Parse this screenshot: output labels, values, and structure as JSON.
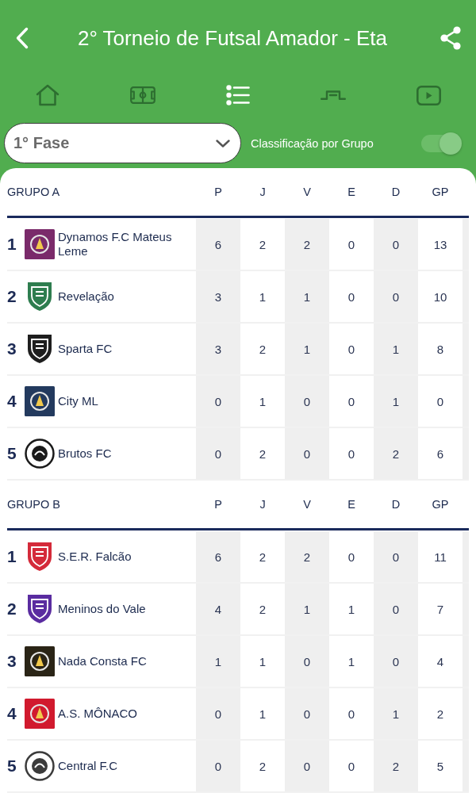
{
  "header": {
    "title": "2° Torneio de Futsal Amador - Eta"
  },
  "nav_tabs": [
    {
      "kind": "home",
      "selected": false
    },
    {
      "kind": "field",
      "selected": false
    },
    {
      "kind": "list",
      "selected": true
    },
    {
      "kind": "bracket",
      "selected": false
    },
    {
      "kind": "video",
      "selected": false
    }
  ],
  "phase_select": {
    "value": "1° Fase"
  },
  "group_toggle": {
    "label": "Classificação por Grupo",
    "on": true
  },
  "groups": [
    {
      "title": "GRUPO A",
      "columns": [
        "P",
        "J",
        "V",
        "E",
        "D",
        "GP"
      ],
      "rows": [
        {
          "rank": "1",
          "team": "Dynamos F.C Mateus Leme",
          "crest": {
            "kind": "square",
            "color": "#7a2a6a"
          },
          "stats": [
            "6",
            "2",
            "2",
            "0",
            "0",
            "13"
          ]
        },
        {
          "rank": "2",
          "team": "Revelação",
          "crest": {
            "kind": "shield",
            "color": "#2e7d4f"
          },
          "stats": [
            "3",
            "1",
            "1",
            "0",
            "0",
            "10"
          ]
        },
        {
          "rank": "3",
          "team": "Sparta FC",
          "crest": {
            "kind": "shield",
            "color": "#1e1e1e"
          },
          "stats": [
            "3",
            "2",
            "1",
            "0",
            "1",
            "8"
          ]
        },
        {
          "rank": "4",
          "team": "City ML",
          "crest": {
            "kind": "square",
            "color": "#233a5e"
          },
          "stats": [
            "0",
            "1",
            "0",
            "0",
            "1",
            "0"
          ]
        },
        {
          "rank": "5",
          "team": "Brutos FC",
          "crest": {
            "kind": "round",
            "color": "#1a1a1a"
          },
          "stats": [
            "0",
            "2",
            "0",
            "0",
            "2",
            "6"
          ]
        }
      ]
    },
    {
      "title": "GRUPO B",
      "columns": [
        "P",
        "J",
        "V",
        "E",
        "D",
        "GP"
      ],
      "rows": [
        {
          "rank": "1",
          "team": "S.E.R. Falcão",
          "crest": {
            "kind": "shield",
            "color": "#d42a3a"
          },
          "stats": [
            "6",
            "2",
            "2",
            "0",
            "0",
            "11"
          ]
        },
        {
          "rank": "2",
          "team": "Meninos do Vale",
          "crest": {
            "kind": "shield",
            "color": "#5a2ca0"
          },
          "stats": [
            "4",
            "2",
            "1",
            "1",
            "0",
            "7"
          ]
        },
        {
          "rank": "3",
          "team": "Nada Consta FC",
          "crest": {
            "kind": "square",
            "color": "#2a2416"
          },
          "stats": [
            "1",
            "1",
            "0",
            "1",
            "0",
            "4"
          ]
        },
        {
          "rank": "4",
          "team": "A.S. MÔNACO",
          "crest": {
            "kind": "square",
            "color": "#d11a2e"
          },
          "stats": [
            "0",
            "1",
            "0",
            "0",
            "1",
            "2"
          ]
        },
        {
          "rank": "5",
          "team": "Central F.C",
          "crest": {
            "kind": "round",
            "color": "#3b3b3b"
          },
          "stats": [
            "0",
            "2",
            "0",
            "0",
            "2",
            "5"
          ]
        }
      ]
    }
  ]
}
